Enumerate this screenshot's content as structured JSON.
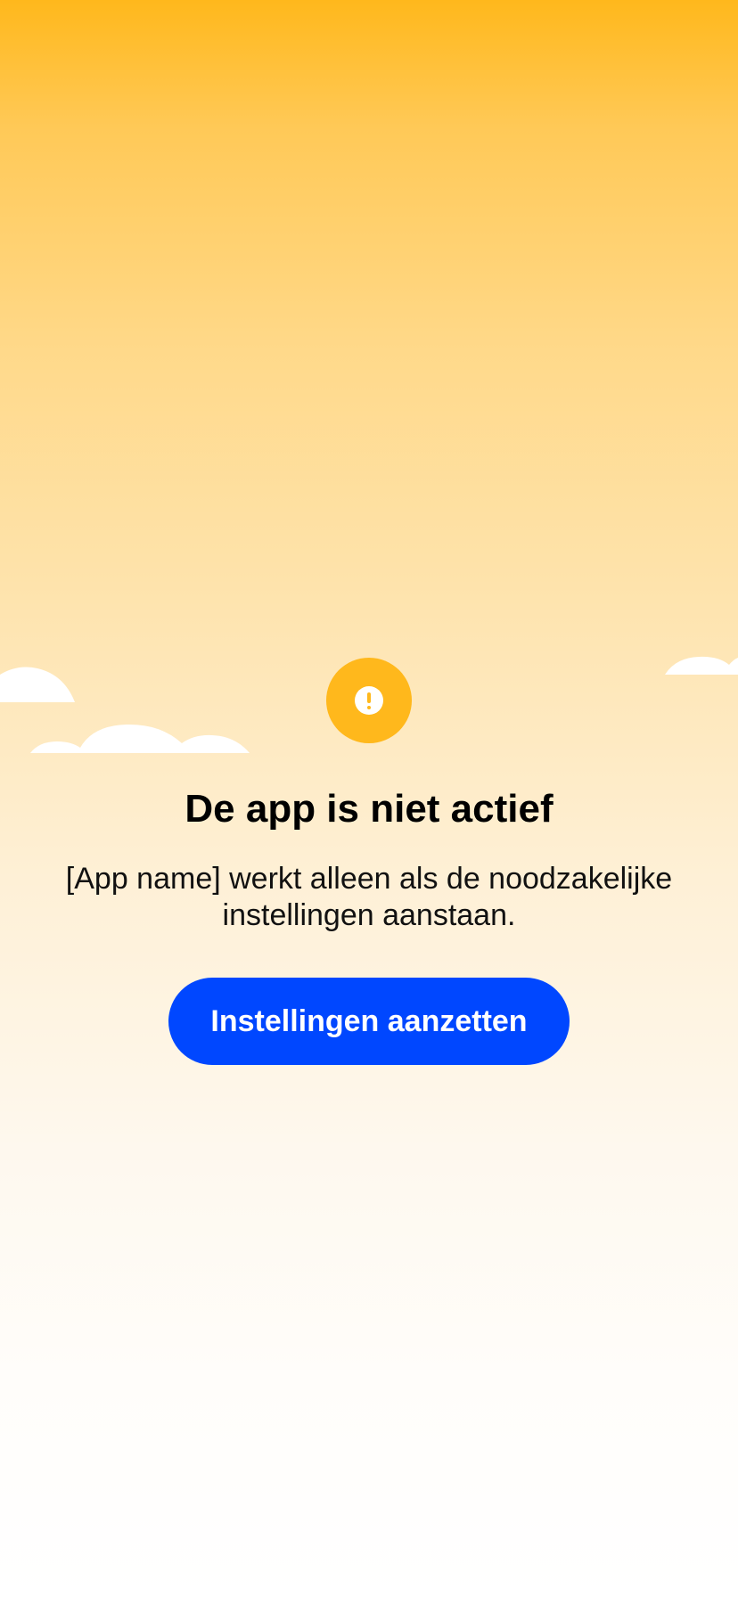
{
  "screen": {
    "title": "De app is niet actief",
    "message": "[App name] werkt alleen als de noodzakelijke instellingen aanstaan.",
    "button_label": "Instellingen aanzetten",
    "icon": "exclamation-circle-icon"
  },
  "colors": {
    "accent": "#FFB81C",
    "button": "#0047FF",
    "button_text": "#FFFFFF"
  }
}
